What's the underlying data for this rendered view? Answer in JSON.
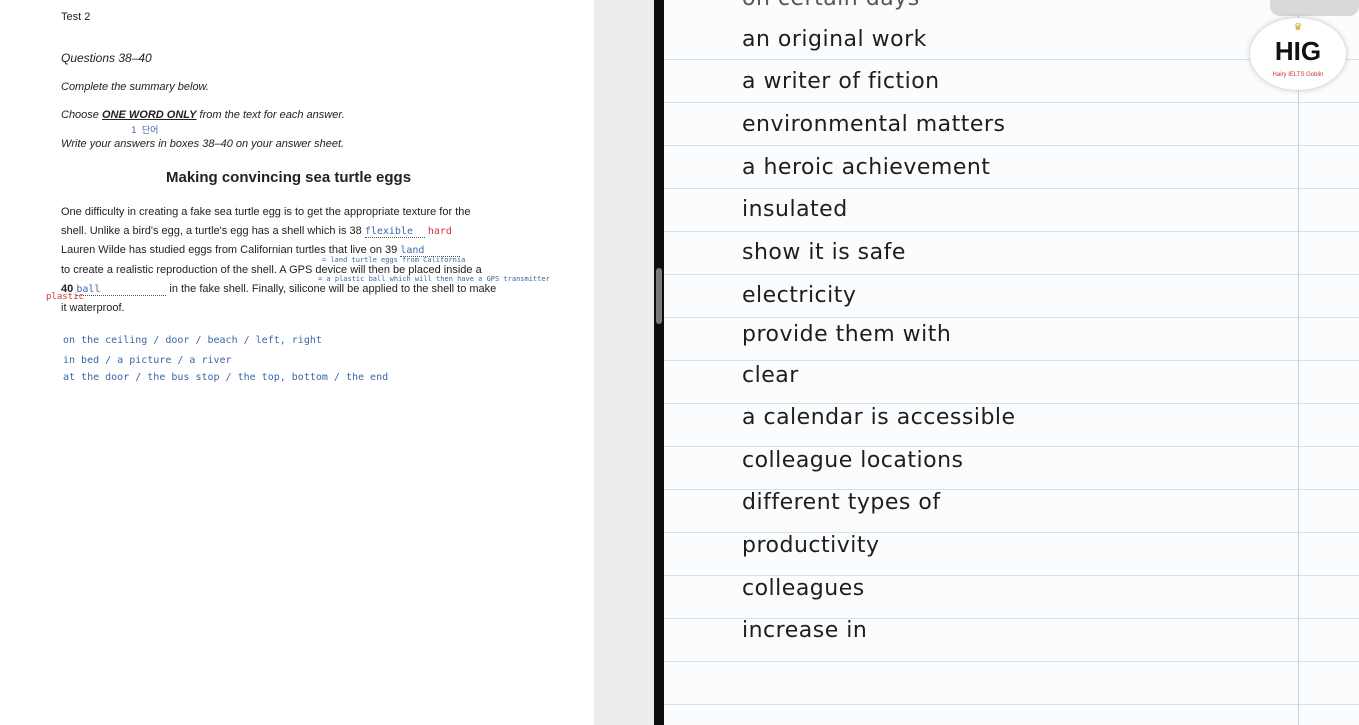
{
  "doc": {
    "test_label": "Test 2",
    "questions_label": "Questions 38–40",
    "instr_complete": "Complete the summary below.",
    "instr_choose_pre": "Choose ",
    "instr_choose_emph": "ONE WORD ONLY",
    "instr_choose_post": " from the text for each answer.",
    "instr_write": "Write your answers in boxes 38–40 on your answer sheet.",
    "summary_title": "Making convincing sea turtle eggs",
    "para_line1": "One difficulty in creating a fake sea turtle egg is to get the appropriate texture for the",
    "para_line2": "shell. Unlike a bird's egg, a turtle's egg has a shell which is 38",
    "para_line3": "Lauren Wilde has studied eggs from Californian turtles that live on 39",
    "para_line4": "to create a realistic reproduction of the shell. A GPS device will then be placed inside a",
    "para_line5_num": "40",
    "para_line5_rest": "in the fake shell. Finally, silicone will be applied to the shell to make",
    "para_line6": "it waterproof.",
    "ans38": "flexible",
    "ans38_note": "hard",
    "ans39": "land",
    "ans40": "ball",
    "ans40_note": "plastic",
    "note_one_word": "1 단어",
    "note_39_line": "= land turtle eggs from California",
    "note_40_line": "= a plastic ball which will then have a GPS transmitter",
    "prep_on": "on  the ceiling / door / beach / left, right",
    "prep_in": "in  bed / a picture / a river",
    "prep_at": "at  the door / the  bus stop / the top, bottom / the end"
  },
  "notebook": {
    "lines": [
      "an original work",
      "a writer of fiction",
      "environmental matters",
      "a heroic achievement",
      "insulated",
      "show it is safe",
      "electricity",
      "provide them with",
      "clear",
      "a calendar is accessible",
      "colleague locations",
      "different types of",
      "productivity",
      "colleagues",
      "increase in"
    ],
    "top_cut": "on certain days"
  },
  "badge": {
    "title": "HIG",
    "subtitle": "Hairy IELTS Goblin"
  }
}
